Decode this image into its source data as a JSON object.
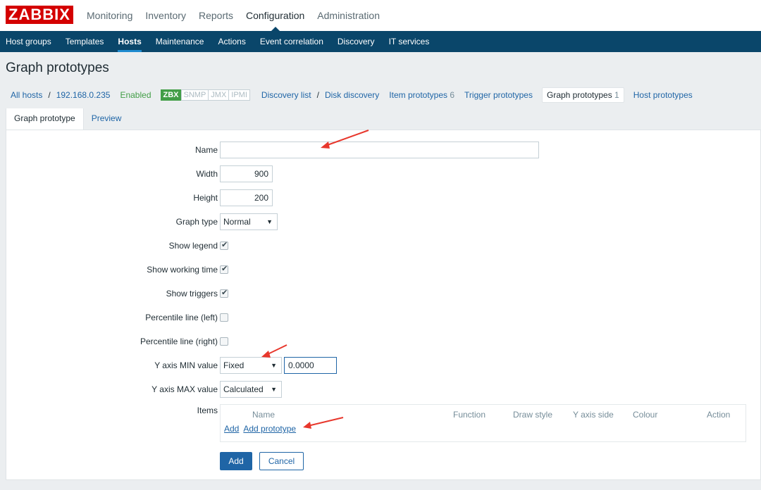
{
  "logo": "ZABBIX",
  "top_menu": [
    {
      "label": "Monitoring",
      "active": false
    },
    {
      "label": "Inventory",
      "active": false
    },
    {
      "label": "Reports",
      "active": false
    },
    {
      "label": "Configuration",
      "active": true
    },
    {
      "label": "Administration",
      "active": false
    }
  ],
  "sub_menu": [
    {
      "label": "Host groups",
      "active": false
    },
    {
      "label": "Templates",
      "active": false
    },
    {
      "label": "Hosts",
      "active": true
    },
    {
      "label": "Maintenance",
      "active": false
    },
    {
      "label": "Actions",
      "active": false
    },
    {
      "label": "Event correlation",
      "active": false
    },
    {
      "label": "Discovery",
      "active": false
    },
    {
      "label": "IT services",
      "active": false
    }
  ],
  "page_title": "Graph prototypes",
  "host_nav": {
    "all_hosts": "All hosts",
    "host": "192.168.0.235",
    "status": "Enabled",
    "badges": [
      {
        "label": "ZBX",
        "on": true
      },
      {
        "label": "SNMP",
        "on": false
      },
      {
        "label": "JMX",
        "on": false
      },
      {
        "label": "IPMI",
        "on": false
      }
    ],
    "discovery_list": "Discovery list",
    "discovery_rule": "Disk discovery",
    "item_prototypes": "Item prototypes",
    "item_prototypes_count": "6",
    "trigger_prototypes": "Trigger prototypes",
    "graph_prototypes": "Graph prototypes",
    "graph_prototypes_count": "1",
    "host_prototypes": "Host prototypes"
  },
  "tabs": [
    "Graph prototype",
    "Preview"
  ],
  "form": {
    "name_label": "Name",
    "name_value": "",
    "width_label": "Width",
    "width_value": "900",
    "height_label": "Height",
    "height_value": "200",
    "graph_type_label": "Graph type",
    "graph_type_value": "Normal",
    "show_legend_label": "Show legend",
    "show_legend": true,
    "show_working_time_label": "Show working time",
    "show_working_time": true,
    "show_triggers_label": "Show triggers",
    "show_triggers": true,
    "percentile_left_label": "Percentile line (left)",
    "percentile_left": false,
    "percentile_right_label": "Percentile line (right)",
    "percentile_right": false,
    "ymin_label": "Y axis MIN value",
    "ymin_type": "Fixed",
    "ymin_value": "0.0000",
    "ymax_label": "Y axis MAX value",
    "ymax_type": "Calculated",
    "items_label": "Items",
    "items_columns": [
      "Name",
      "Function",
      "Draw style",
      "Y axis side",
      "Colour",
      "Action"
    ],
    "add_link": "Add",
    "add_prototype_link": "Add prototype",
    "add_button": "Add",
    "cancel_button": "Cancel"
  },
  "colors": {
    "brand": "#d40000",
    "nav_dark": "#0a466a",
    "link": "#1f65a6",
    "enabled": "#429e47",
    "annotation_arrow": "#e8372c"
  }
}
